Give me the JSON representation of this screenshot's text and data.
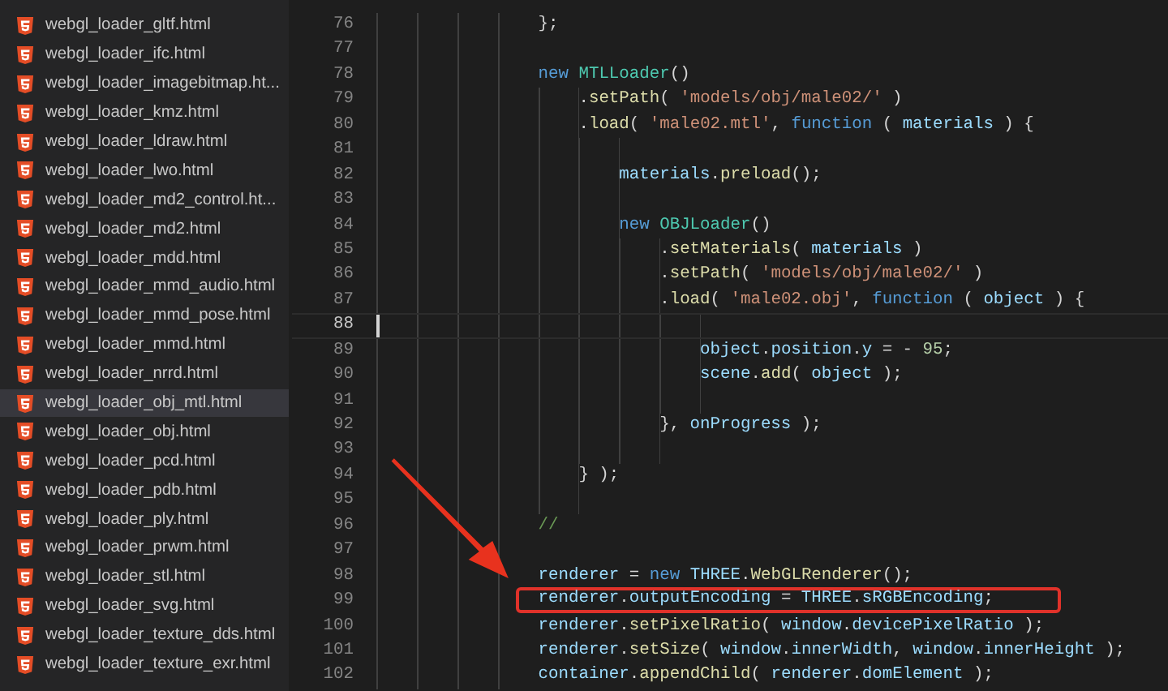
{
  "sidebar": {
    "items": [
      {
        "label": "webgl_loader_gltf.html",
        "selected": false
      },
      {
        "label": "webgl_loader_ifc.html",
        "selected": false
      },
      {
        "label": "webgl_loader_imagebitmap.ht...",
        "selected": false
      },
      {
        "label": "webgl_loader_kmz.html",
        "selected": false
      },
      {
        "label": "webgl_loader_ldraw.html",
        "selected": false
      },
      {
        "label": "webgl_loader_lwo.html",
        "selected": false
      },
      {
        "label": "webgl_loader_md2_control.ht...",
        "selected": false
      },
      {
        "label": "webgl_loader_md2.html",
        "selected": false
      },
      {
        "label": "webgl_loader_mdd.html",
        "selected": false
      },
      {
        "label": "webgl_loader_mmd_audio.html",
        "selected": false
      },
      {
        "label": "webgl_loader_mmd_pose.html",
        "selected": false
      },
      {
        "label": "webgl_loader_mmd.html",
        "selected": false
      },
      {
        "label": "webgl_loader_nrrd.html",
        "selected": false
      },
      {
        "label": "webgl_loader_obj_mtl.html",
        "selected": true
      },
      {
        "label": "webgl_loader_obj.html",
        "selected": false
      },
      {
        "label": "webgl_loader_pcd.html",
        "selected": false
      },
      {
        "label": "webgl_loader_pdb.html",
        "selected": false
      },
      {
        "label": "webgl_loader_ply.html",
        "selected": false
      },
      {
        "label": "webgl_loader_prwm.html",
        "selected": false
      },
      {
        "label": "webgl_loader_stl.html",
        "selected": false
      },
      {
        "label": "webgl_loader_svg.html",
        "selected": false
      },
      {
        "label": "webgl_loader_texture_dds.html",
        "selected": false
      },
      {
        "label": "webgl_loader_texture_exr.html",
        "selected": false
      }
    ]
  },
  "editor": {
    "lines": [
      {
        "number": "76",
        "current": false,
        "boxed": false,
        "tokens": [
          {
            "text": "                };",
            "kind": "p"
          }
        ]
      },
      {
        "number": "77",
        "current": false,
        "boxed": false
      },
      {
        "number": "78",
        "current": false,
        "boxed": false,
        "tokens": [
          {
            "text": "                new ",
            "kind": "kw"
          },
          {
            "text": "MTLLoader",
            "kind": "cls"
          },
          {
            "text": "()",
            "kind": "p"
          }
        ]
      },
      {
        "number": "79",
        "current": false,
        "boxed": false,
        "tokens": [
          {
            "text": "                    .",
            "kind": "p"
          },
          {
            "text": "setPath",
            "kind": "fn"
          },
          {
            "text": "( ",
            "kind": "p"
          },
          {
            "text": "'models/obj/male02/'",
            "kind": "str"
          },
          {
            "text": " )",
            "kind": "p"
          }
        ]
      },
      {
        "number": "80",
        "current": false,
        "boxed": false,
        "tokens": [
          {
            "text": "                    .",
            "kind": "p"
          },
          {
            "text": "load",
            "kind": "fn"
          },
          {
            "text": "( ",
            "kind": "p"
          },
          {
            "text": "'male02.mtl'",
            "kind": "str"
          },
          {
            "text": ", ",
            "kind": "p"
          },
          {
            "text": "function",
            "kind": "kw"
          },
          {
            "text": " ( ",
            "kind": "p"
          },
          {
            "text": "materials",
            "kind": "var"
          },
          {
            "text": " ) {",
            "kind": "p"
          }
        ]
      },
      {
        "number": "81",
        "current": false,
        "boxed": false
      },
      {
        "number": "82",
        "current": false,
        "boxed": false,
        "tokens": [
          {
            "text": "                        materials",
            "kind": "var"
          },
          {
            "text": ".",
            "kind": "p"
          },
          {
            "text": "preload",
            "kind": "fn"
          },
          {
            "text": "();",
            "kind": "p"
          }
        ]
      },
      {
        "number": "83",
        "current": false,
        "boxed": false
      },
      {
        "number": "84",
        "current": false,
        "boxed": false,
        "tokens": [
          {
            "text": "                        new ",
            "kind": "kw"
          },
          {
            "text": "OBJLoader",
            "kind": "cls"
          },
          {
            "text": "()",
            "kind": "p"
          }
        ]
      },
      {
        "number": "85",
        "current": false,
        "boxed": false,
        "tokens": [
          {
            "text": "                            .",
            "kind": "p"
          },
          {
            "text": "setMaterials",
            "kind": "fn"
          },
          {
            "text": "( ",
            "kind": "p"
          },
          {
            "text": "materials",
            "kind": "var"
          },
          {
            "text": " )",
            "kind": "p"
          }
        ]
      },
      {
        "number": "86",
        "current": false,
        "boxed": false,
        "tokens": [
          {
            "text": "                            .",
            "kind": "p"
          },
          {
            "text": "setPath",
            "kind": "fn"
          },
          {
            "text": "( ",
            "kind": "p"
          },
          {
            "text": "'models/obj/male02/'",
            "kind": "str"
          },
          {
            "text": " )",
            "kind": "p"
          }
        ]
      },
      {
        "number": "87",
        "current": false,
        "boxed": false,
        "tokens": [
          {
            "text": "                            .",
            "kind": "p"
          },
          {
            "text": "load",
            "kind": "fn"
          },
          {
            "text": "( ",
            "kind": "p"
          },
          {
            "text": "'male02.obj'",
            "kind": "str"
          },
          {
            "text": ", ",
            "kind": "p"
          },
          {
            "text": "function",
            "kind": "kw"
          },
          {
            "text": " ( ",
            "kind": "p"
          },
          {
            "text": "object",
            "kind": "var"
          },
          {
            "text": " ) {",
            "kind": "p"
          }
        ]
      },
      {
        "number": "88",
        "current": true,
        "boxed": false
      },
      {
        "number": "89",
        "current": false,
        "boxed": false,
        "tokens": [
          {
            "text": "                                object",
            "kind": "var"
          },
          {
            "text": ".",
            "kind": "p"
          },
          {
            "text": "position",
            "kind": "var"
          },
          {
            "text": ".",
            "kind": "p"
          },
          {
            "text": "y",
            "kind": "var"
          },
          {
            "text": " = - ",
            "kind": "p"
          },
          {
            "text": "95",
            "kind": "num"
          },
          {
            "text": ";",
            "kind": "p"
          }
        ]
      },
      {
        "number": "90",
        "current": false,
        "boxed": false,
        "tokens": [
          {
            "text": "                                scene",
            "kind": "var"
          },
          {
            "text": ".",
            "kind": "p"
          },
          {
            "text": "add",
            "kind": "fn"
          },
          {
            "text": "( ",
            "kind": "p"
          },
          {
            "text": "object",
            "kind": "var"
          },
          {
            "text": " );",
            "kind": "p"
          }
        ]
      },
      {
        "number": "91",
        "current": false,
        "boxed": false
      },
      {
        "number": "92",
        "current": false,
        "boxed": false,
        "tokens": [
          {
            "text": "                            }, ",
            "kind": "p"
          },
          {
            "text": "onProgress",
            "kind": "var"
          },
          {
            "text": " );",
            "kind": "p"
          }
        ]
      },
      {
        "number": "93",
        "current": false,
        "boxed": false
      },
      {
        "number": "94",
        "current": false,
        "boxed": false,
        "tokens": [
          {
            "text": "                    } );",
            "kind": "p"
          }
        ]
      },
      {
        "number": "95",
        "current": false,
        "boxed": false
      },
      {
        "number": "96",
        "current": false,
        "boxed": false,
        "tokens": [
          {
            "text": "                //",
            "kind": "cm"
          }
        ]
      },
      {
        "number": "97",
        "current": false,
        "boxed": false
      },
      {
        "number": "98",
        "current": false,
        "boxed": false,
        "tokens": [
          {
            "text": "                renderer",
            "kind": "var"
          },
          {
            "text": " = ",
            "kind": "p"
          },
          {
            "text": "new ",
            "kind": "kw"
          },
          {
            "text": "THREE",
            "kind": "var"
          },
          {
            "text": ".",
            "kind": "p"
          },
          {
            "text": "WebGLRenderer",
            "kind": "fn"
          },
          {
            "text": "();",
            "kind": "p"
          }
        ]
      },
      {
        "number": "99",
        "current": false,
        "boxed": true,
        "tokens": [
          {
            "text": "                renderer",
            "kind": "var"
          },
          {
            "text": ".",
            "kind": "p"
          },
          {
            "text": "outputEncoding",
            "kind": "var"
          },
          {
            "text": " = ",
            "kind": "p"
          },
          {
            "text": "THREE",
            "kind": "var"
          },
          {
            "text": ".",
            "kind": "p"
          },
          {
            "text": "sRGBEncoding",
            "kind": "var"
          },
          {
            "text": ";",
            "kind": "p"
          }
        ]
      },
      {
        "number": "100",
        "current": false,
        "boxed": false,
        "tokens": [
          {
            "text": "                renderer",
            "kind": "var"
          },
          {
            "text": ".",
            "kind": "p"
          },
          {
            "text": "setPixelRatio",
            "kind": "fn"
          },
          {
            "text": "( ",
            "kind": "p"
          },
          {
            "text": "window",
            "kind": "var"
          },
          {
            "text": ".",
            "kind": "p"
          },
          {
            "text": "devicePixelRatio",
            "kind": "var"
          },
          {
            "text": " );",
            "kind": "p"
          }
        ]
      },
      {
        "number": "101",
        "current": false,
        "boxed": false,
        "tokens": [
          {
            "text": "                renderer",
            "kind": "var"
          },
          {
            "text": ".",
            "kind": "p"
          },
          {
            "text": "setSize",
            "kind": "fn"
          },
          {
            "text": "( ",
            "kind": "p"
          },
          {
            "text": "window",
            "kind": "var"
          },
          {
            "text": ".",
            "kind": "p"
          },
          {
            "text": "innerWidth",
            "kind": "var"
          },
          {
            "text": ", ",
            "kind": "p"
          },
          {
            "text": "window",
            "kind": "var"
          },
          {
            "text": ".",
            "kind": "p"
          },
          {
            "text": "innerHeight",
            "kind": "var"
          },
          {
            "text": " );",
            "kind": "p"
          }
        ]
      },
      {
        "number": "102",
        "current": false,
        "boxed": false,
        "tokens": [
          {
            "text": "                container",
            "kind": "var"
          },
          {
            "text": ".",
            "kind": "p"
          },
          {
            "text": "appendChild",
            "kind": "fn"
          },
          {
            "text": "( ",
            "kind": "p"
          },
          {
            "text": "renderer",
            "kind": "var"
          },
          {
            "text": ".",
            "kind": "p"
          },
          {
            "text": "domElement",
            "kind": "var"
          },
          {
            "text": " );",
            "kind": "p"
          }
        ]
      }
    ]
  }
}
